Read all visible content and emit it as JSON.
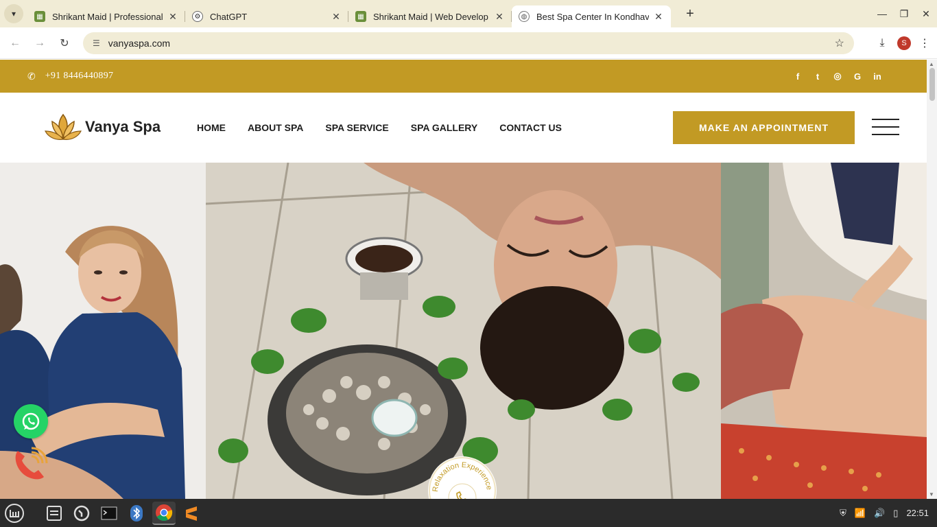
{
  "browser": {
    "tabs": [
      {
        "label": "Shrikant Maid | Professional",
        "active": false
      },
      {
        "label": "ChatGPT",
        "active": false
      },
      {
        "label": "Shrikant Maid | Web Develop",
        "active": false
      },
      {
        "label": "Best Spa Center In Kondhava",
        "active": true
      }
    ],
    "url": "vanyaspa.com",
    "profile_initial": "S"
  },
  "site": {
    "topbar": {
      "phone": "+91 8446440897",
      "socials": [
        "facebook-icon",
        "twitter-icon",
        "instagram-icon",
        "google-icon",
        "linkedin-icon"
      ],
      "social_glyphs": [
        "f",
        "t",
        "◎",
        "G",
        "in"
      ]
    },
    "brand": "Vanya Spa",
    "nav": [
      "HOME",
      "ABOUT SPA",
      "SPA SERVICE",
      "SPA GALLERY",
      "CONTACT US"
    ],
    "cta": "MAKE AN APPOINTMENT",
    "badge_text": "Relaxation Experience at"
  },
  "colors": {
    "accent": "#c29a24",
    "whatsapp": "#25d366",
    "call": "#e74c3c"
  },
  "taskbar": {
    "clock": "22:51"
  }
}
